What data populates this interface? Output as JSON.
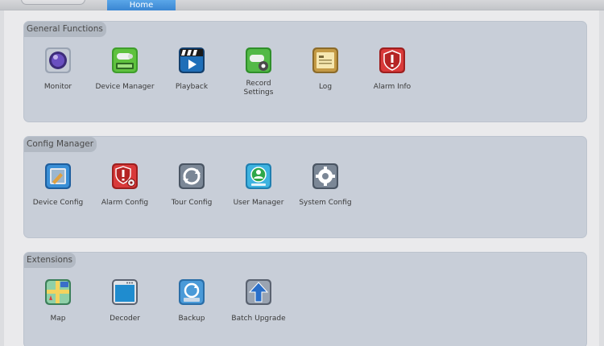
{
  "header": {
    "home_tab": "Home"
  },
  "sections": [
    {
      "title": "General Functions",
      "items": [
        {
          "label": "Monitor",
          "icon": "monitor-icon"
        },
        {
          "label": "Device Manager",
          "icon": "device-manager-icon"
        },
        {
          "label": "Playback",
          "icon": "playback-icon"
        },
        {
          "label": "Record\nSettings",
          "icon": "record-settings-icon"
        },
        {
          "label": "Log",
          "icon": "log-icon"
        },
        {
          "label": "Alarm Info",
          "icon": "alarm-info-icon"
        }
      ]
    },
    {
      "title": "Config Manager",
      "items": [
        {
          "label": "Device Config",
          "icon": "device-config-icon"
        },
        {
          "label": "Alarm Config",
          "icon": "alarm-config-icon"
        },
        {
          "label": "Tour Config",
          "icon": "tour-config-icon"
        },
        {
          "label": "User Manager",
          "icon": "user-manager-icon"
        },
        {
          "label": "System Config",
          "icon": "system-config-icon"
        }
      ]
    },
    {
      "title": "Extensions",
      "items": [
        {
          "label": "Map",
          "icon": "map-icon"
        },
        {
          "label": "Decoder",
          "icon": "decoder-icon"
        },
        {
          "label": "Backup",
          "icon": "backup-icon"
        },
        {
          "label": "Batch Upgrade",
          "icon": "batch-upgrade-icon"
        }
      ]
    }
  ]
}
